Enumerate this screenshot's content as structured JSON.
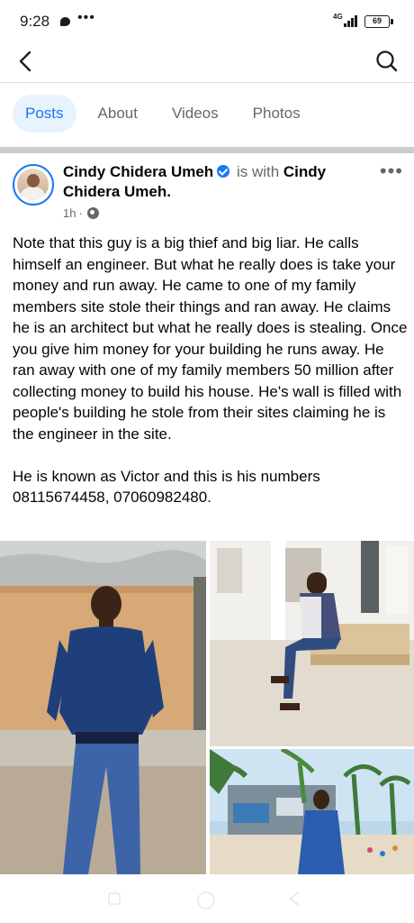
{
  "status_bar": {
    "time": "9:28",
    "network": "4G",
    "battery": "69"
  },
  "nav": {
    "back_icon": "chevron-left-icon",
    "search_icon": "search-icon"
  },
  "tabs": [
    {
      "label": "Posts",
      "active": true
    },
    {
      "label": "About",
      "active": false
    },
    {
      "label": "Videos",
      "active": false
    },
    {
      "label": "Photos",
      "active": false
    }
  ],
  "post": {
    "author": "Cindy Chidera Umeh",
    "with_text": "is with",
    "tagged": "Cindy Chidera Umeh",
    "tagged_suffix": ".",
    "time": "1h",
    "separator": "·",
    "privacy_icon": "globe-icon",
    "more_icon": "more-icon",
    "more_label": "•••",
    "text": "Note that this guy is a big thief and big liar. He calls himself an engineer. But what he really does is take your money and run away. He came to one of my family members site stole their things and ran away. He claims he is an architect but what he really does is stealing. Once you give him money for your building he runs away. He ran away with one of my family members 50 million after collecting money to build his house. He's wall is filled with people's building he stole from their sites claiming he is the engineer in the site.\n\nHe is known as Victor and this is his numbers 08115674458, 07060982480."
  },
  "colors": {
    "accent": "#1877f2",
    "tab_active_bg": "#e7f3ff",
    "secondary_text": "#65676b"
  }
}
